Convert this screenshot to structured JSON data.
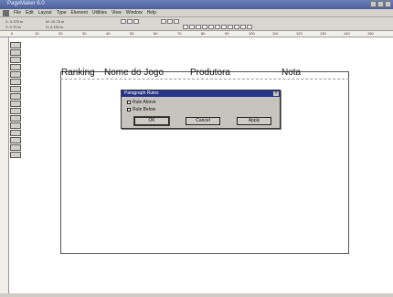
{
  "window": {
    "title": "PageMaker 6.0"
  },
  "menu": [
    "File",
    "Edit",
    "Layout",
    "Type",
    "Element",
    "Utilities",
    "View",
    "Window",
    "Help"
  ],
  "table_headers": [
    "Ranking",
    "Nome do Jogo",
    "Produtora",
    "Nota"
  ],
  "dialog": {
    "title": "Paragraph Rules",
    "close_glyph": "×",
    "options": [
      {
        "label": "Rule Above"
      },
      {
        "label": "Rule Below"
      }
    ],
    "buttons": {
      "ok": "OK",
      "cancel": "Cancel",
      "apply": "Apply"
    }
  },
  "toolbar": {
    "x_readout": "X: 0.375 in",
    "y_readout": "Y: 0.75 in",
    "w_readout": "W: 10.75 in",
    "h_readout": "H: 0.153 in"
  },
  "ruler": [
    "0",
    "10",
    "20",
    "30",
    "40",
    "50",
    "60",
    "70",
    "80",
    "90",
    "100",
    "110",
    "120",
    "130",
    "140",
    "150"
  ]
}
